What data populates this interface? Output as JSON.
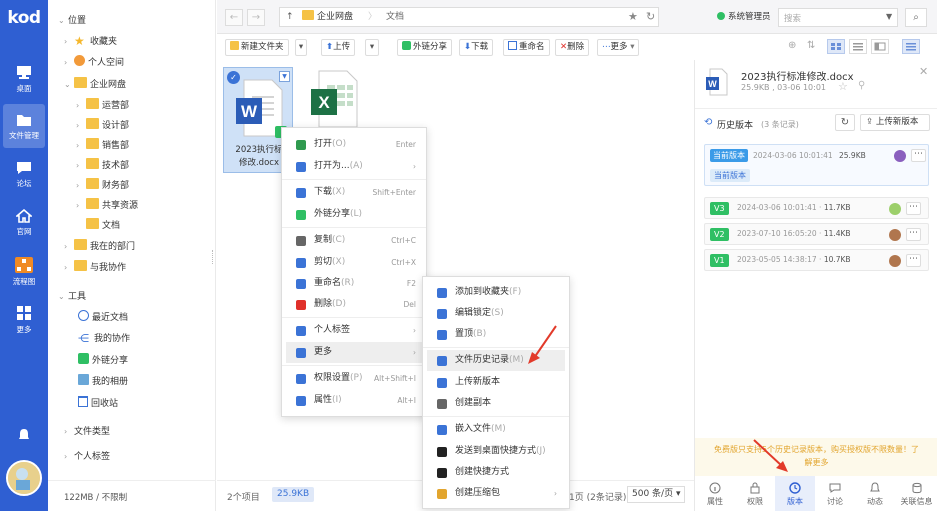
{
  "app": {
    "logo": "kod"
  },
  "leftnav": [
    {
      "label": "桌面",
      "icon": "monitor-icon"
    },
    {
      "label": "文件管理",
      "icon": "folder-icon",
      "active": true
    },
    {
      "label": "论坛",
      "icon": "chat-icon"
    },
    {
      "label": "官网",
      "icon": "home-icon"
    },
    {
      "label": "流程图",
      "icon": "flowchart-icon"
    },
    {
      "label": "更多",
      "icon": "grid-icon"
    }
  ],
  "tree": {
    "location": "位置",
    "favorites": "收藏夹",
    "personal": "个人空间",
    "enterprise": "企业网盘",
    "depts": [
      "运营部",
      "设计部",
      "销售部",
      "技术部",
      "财务部",
      "共享资源",
      "文档"
    ],
    "mydept": "我在的部门",
    "collab": "与我协作",
    "tools": "工具",
    "tools_items": [
      "最近文档",
      "我的协作",
      "外链分享",
      "我的相册",
      "回收站"
    ],
    "filetypes": "文件类型",
    "tags": "个人标签",
    "quota": "122MB / 不限制"
  },
  "topbar": {
    "back": "←",
    "fwd": "→",
    "crumbs": [
      "企业网盘",
      "文档"
    ],
    "user": "系统管理员",
    "search_placeholder": "搜索"
  },
  "toolbar": {
    "new_folder": "新建文件夹",
    "upload": "上传",
    "share": "外链分享",
    "download": "下载",
    "rename": "重命名",
    "delete": "删除",
    "more": "更多"
  },
  "files": [
    {
      "name": "2023执行标准修改.docx",
      "label1": "2023执行标",
      "label2": "修改.docx",
      "type": "docx"
    },
    {
      "name": "",
      "type": "xlsx"
    }
  ],
  "status": {
    "count": "2个项目",
    "size": "25.9KB",
    "page": "1页 (2条记录)",
    "per_page": "500 条/页"
  },
  "menu1": [
    {
      "label": "打开",
      "hk": "(O)",
      "sc": "Enter",
      "icon": "open-icon",
      "color": "#2f9a4f"
    },
    {
      "label": "打开为...",
      "hk": "(A)",
      "sc": "›",
      "icon": "open-as-icon",
      "color": "#3b73d6"
    },
    {
      "label": "下载",
      "hk": "(X)",
      "sc": "Shift+Enter",
      "icon": "download-icon",
      "color": "#3b73d6"
    },
    {
      "label": "外链分享",
      "hk": "(L)",
      "sc": "",
      "icon": "share-icon",
      "color": "#2fbf64"
    },
    {
      "label": "复制",
      "hk": "(C)",
      "sc": "Ctrl+C",
      "icon": "copy-icon",
      "color": "#666666"
    },
    {
      "label": "剪切",
      "hk": "(X)",
      "sc": "Ctrl+X",
      "icon": "cut-icon",
      "color": "#3b73d6"
    },
    {
      "label": "重命名",
      "hk": "(R)",
      "sc": "F2",
      "icon": "rename-icon",
      "color": "#3b73d6"
    },
    {
      "label": "删除",
      "hk": "(D)",
      "sc": "Del",
      "icon": "delete-icon",
      "color": "#e0302a"
    },
    {
      "label": "个人标签",
      "hk": "",
      "sc": "›",
      "icon": "tag-icon",
      "color": "#3b73d6"
    },
    {
      "label": "更多",
      "hk": "",
      "sc": "›",
      "icon": "more-icon",
      "color": "#3b73d6"
    },
    {
      "label": "权限设置",
      "hk": "(P)",
      "sc": "Alt+Shift+I",
      "icon": "permission-icon",
      "color": "#3b73d6"
    },
    {
      "label": "属性",
      "hk": "(I)",
      "sc": "Alt+I",
      "icon": "info-icon",
      "color": "#3b73d6"
    }
  ],
  "menu2": [
    {
      "label": "添加到收藏夹",
      "hk": "(F)",
      "icon": "star-icon",
      "color": "#3b73d6"
    },
    {
      "label": "编辑锁定",
      "hk": "(S)",
      "icon": "lock-icon",
      "color": "#3b73d6"
    },
    {
      "label": "置顶",
      "hk": "(B)",
      "icon": "pin-icon",
      "color": "#3b73d6"
    },
    {
      "label": "文件历史记录",
      "hk": "(M)",
      "icon": "history-icon",
      "color": "#3b73d6"
    },
    {
      "label": "上传新版本",
      "hk": "",
      "icon": "upload-icon",
      "color": "#3b73d6"
    },
    {
      "label": "创建副本",
      "hk": "",
      "icon": "duplicate-icon",
      "color": "#666666"
    },
    {
      "label": "嵌入文件",
      "hk": "(M)",
      "icon": "embed-icon",
      "color": "#3b73d6"
    },
    {
      "label": "发送到桌面快捷方式",
      "hk": "(J)",
      "icon": "desktop-shortcut-icon",
      "color": "#222222"
    },
    {
      "label": "创建快捷方式",
      "hk": "",
      "icon": "shortcut-icon",
      "color": "#222222"
    },
    {
      "label": "创建压缩包",
      "hk": "",
      "sc": "›",
      "icon": "zip-icon",
      "color": "#e2a52e"
    }
  ],
  "panel": {
    "file_name": "2023执行标准修改.docx",
    "file_meta": "25.9KB , 03-06 10:01",
    "section": "历史版本",
    "count": "(3 条记录)",
    "upload_new": "上传新版本",
    "current_badge": "当前版本",
    "current_time": "2024-03-06 10:01:41",
    "current_size": "25.9KB",
    "current_tag": "当前版本",
    "versions": [
      {
        "v": "V3",
        "time": "2024-03-06 10:01:41",
        "size": "11.7KB"
      },
      {
        "v": "V2",
        "time": "2023-07-10 16:05:20",
        "size": "11.4KB"
      },
      {
        "v": "V1",
        "time": "2023-05-05 14:38:17",
        "size": "10.7KB"
      }
    ],
    "notice1": "免费版只支持5个历史记录版本，购买授权版不限数量！了",
    "notice2": "解更多",
    "tabs": [
      "属性",
      "权限",
      "版本",
      "讨论",
      "动态",
      "关联信息"
    ]
  },
  "colors": {
    "brand": "#2f5fd2",
    "accent": "#3b73d6",
    "green": "#2fbf64",
    "red": "#e0302a"
  }
}
